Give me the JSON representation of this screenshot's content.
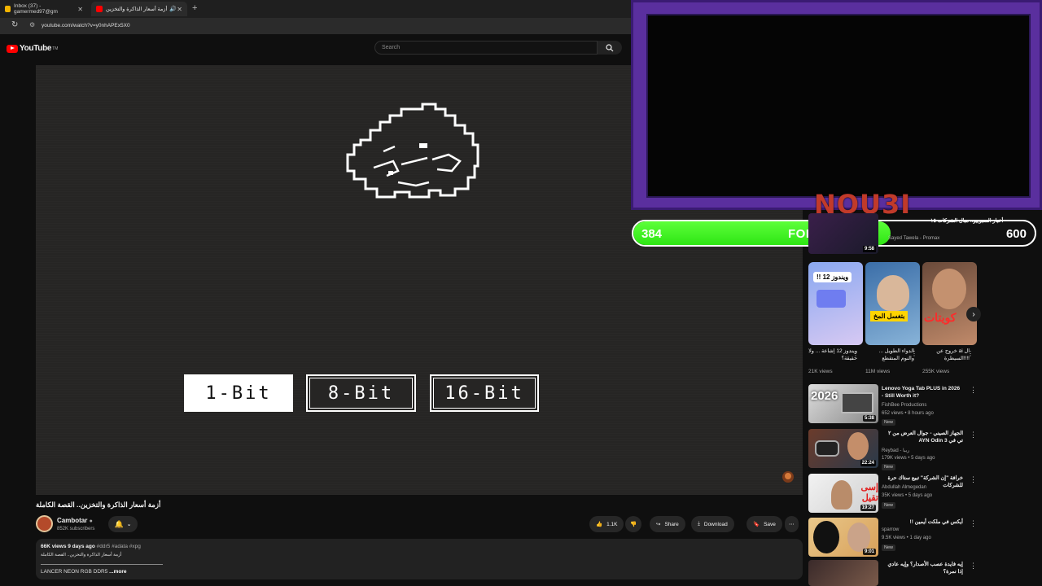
{
  "browser": {
    "tabs": [
      {
        "label": "Inbox (37) - gamermed97@gm",
        "active": false
      },
      {
        "label": "أزمة أسعار الذاكرة والتخزين",
        "active": true
      }
    ],
    "url": "youtube.com/watch?v=y0nhAPEx5X0"
  },
  "header": {
    "logo_text": "YouTube",
    "logo_sup": "TM",
    "search_placeholder": "Search"
  },
  "video": {
    "bit_options": [
      "1-Bit",
      "8-Bit",
      "16-Bit"
    ],
    "selected": "1-Bit"
  },
  "stream_overlay": {
    "name": "NOU3I",
    "followers_current": "384",
    "followers_label": "FOLLOWERS",
    "followers_goal": "600",
    "progress_fraction": 0.64,
    "accent": "#5a2f9e",
    "bar_color": "#2ee614"
  },
  "watch": {
    "title": "أزمة أسعار الذاكرة والتخزين.. القصة الكاملة",
    "channel": "Cambotar",
    "subscribers": "852K subscribers",
    "likes": "1.1K",
    "share": "Share",
    "download": "Download",
    "save": "Save",
    "views": "66K views",
    "age": "9 days ago",
    "tags": "#ddr5 #adata #xpg",
    "desc_line": "أزمة أسعار الذاكرة والتخزين.. القصة الكاملة",
    "lancer": "LANCER NEON RGB DDR5",
    "more": "...more"
  },
  "top_partial": {
    "title": "أخبار السبوبيو.. مبال الشركات ١٥",
    "chan": "Sayed Tawela - Promax",
    "dur": "9:58"
  },
  "shorts": [
    {
      "title": "ويندوز 12 إشاعة ... ولا حقيقة؟",
      "views": "21K views",
      "badge": "ويندوز 12 !!"
    },
    {
      "title": "الدواء الطويل ... والنوم المتقطع",
      "views": "11M views",
      "badge": "بتغسل المخ"
    },
    {
      "title": "خروج عن ai ال السيطرة!!!!",
      "views": "255K views",
      "badge": "كويتات"
    }
  ],
  "recommendations": [
    {
      "title": "Lenovo Yoga Tab PLUS in 2026 - Still Worth it?",
      "channel": "FishBee Productions",
      "views": "652 views • 8 hours ago",
      "badge": "New",
      "duration": "5:38",
      "thumb_text": "2026"
    },
    {
      "title": "الجهاز الصيني - جوال العرض من ٢ تي في AYN Odin 3",
      "channel": "Reybad - ريبا",
      "views": "179K views • 5 days ago",
      "badge": "New",
      "duration": "22:24",
      "thumb_text": ""
    },
    {
      "title": "خرافة \"إن الشركة\" تبيع ستاك حرة للشركات",
      "channel": "Abdullah Almegedan",
      "views": "35K views • 5 days ago",
      "badge": "New",
      "duration": "19:27",
      "thumb_text": "إسى تقيل"
    },
    {
      "title": "أيكس في ملكت أيمين !!",
      "channel": "sparrow",
      "views": "9.5K views • 1 day ago",
      "badge": "New",
      "duration": "9:01",
      "thumb_text": ""
    },
    {
      "title": "إيه فايدة عصب الأصدار؟ وإيه عادي إذا نمرة؟",
      "channel": "",
      "views": "",
      "badge": "",
      "duration": "",
      "thumb_text": ""
    }
  ]
}
